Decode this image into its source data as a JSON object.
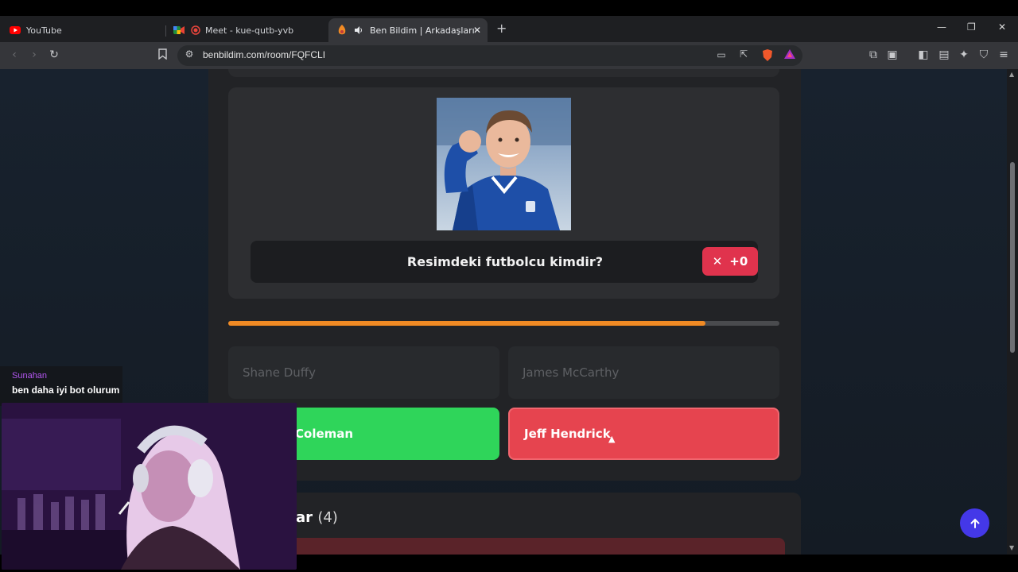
{
  "browser": {
    "tabs": [
      {
        "title": "YouTube",
        "active": false
      },
      {
        "title": "Meet - kue-qutb-yvb",
        "active": false
      },
      {
        "title": "Ben Bildim | Arkadaşlarınla On",
        "active": true
      }
    ],
    "new_tab_label": "+",
    "url": "benbildim.com/room/FQFCLI",
    "window_controls": {
      "minimize": "—",
      "restore": "❐",
      "close": "✕"
    }
  },
  "question": {
    "text": "Resimdeki futbolcu kimdir?",
    "score_icon": "✕",
    "score": "+0",
    "progress_fraction": 0.866
  },
  "options": [
    {
      "label": "Shane Duffy",
      "state": "faded"
    },
    {
      "label": "James McCarthy",
      "state": "faded"
    },
    {
      "label": "Coleman",
      "state": "correct"
    },
    {
      "label": "Jeff Hendrick",
      "state": "wrong"
    }
  ],
  "players": {
    "title_suffix": "ar",
    "count": "(4)"
  },
  "chat": {
    "user": "Sunahan",
    "message": "ben daha iyi bot olurum"
  },
  "colors": {
    "accent_orange": "#f08a24",
    "correct_green": "#2fd55a",
    "wrong_red": "#e6444f",
    "fab_blue": "#4438e8"
  },
  "icons": {
    "fab": "arrow-up-icon"
  }
}
